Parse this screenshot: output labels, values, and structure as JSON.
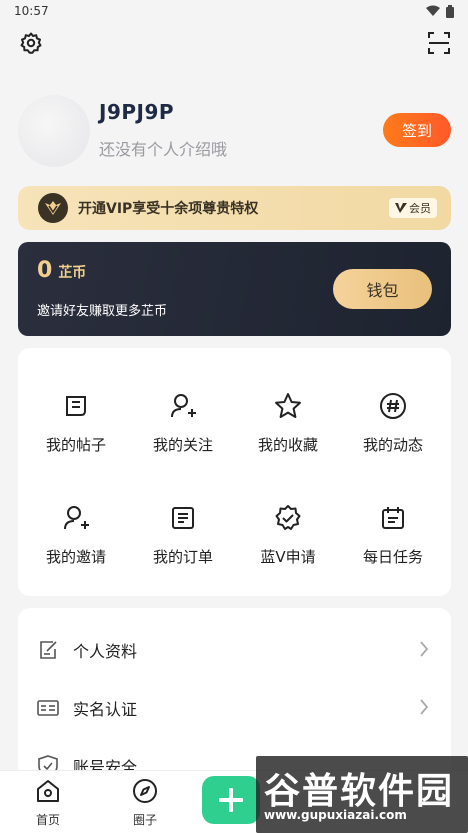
{
  "status_bar": {
    "time": "10:57"
  },
  "profile": {
    "username": "J9PJ9P",
    "bio": "还没有个人介绍哦",
    "checkin_label": "签到"
  },
  "vip": {
    "text": "开通VIP享受十余项尊贵特权",
    "badge": "会员"
  },
  "coins": {
    "amount": "0",
    "unit": "芷币",
    "desc": "邀请好友赚取更多芷币",
    "wallet_label": "钱包"
  },
  "grid": {
    "items": [
      {
        "label": "我的帖子",
        "icon": "post-icon"
      },
      {
        "label": "我的关注",
        "icon": "follow-icon"
      },
      {
        "label": "我的收藏",
        "icon": "star-icon"
      },
      {
        "label": "我的动态",
        "icon": "hashtag-icon"
      },
      {
        "label": "我的邀请",
        "icon": "invite-icon"
      },
      {
        "label": "我的订单",
        "icon": "order-icon"
      },
      {
        "label": "蓝V申请",
        "icon": "badge-check-icon"
      },
      {
        "label": "每日任务",
        "icon": "calendar-icon"
      }
    ]
  },
  "list": {
    "items": [
      {
        "label": "个人资料",
        "icon": "edit-icon"
      },
      {
        "label": "实名认证",
        "icon": "id-card-icon"
      },
      {
        "label": "账号安全",
        "icon": "shield-icon"
      }
    ]
  },
  "nav": {
    "home": "首页",
    "circle": "圈子"
  },
  "watermark": {
    "title": "谷普软件园",
    "url": "www.gupuxiazai.com"
  },
  "colors": {
    "accent_orange": "#ff6a22",
    "vip_gold": "#f3cf8f",
    "dark_card": "#252a38",
    "plus_green": "#2fcf8f"
  }
}
